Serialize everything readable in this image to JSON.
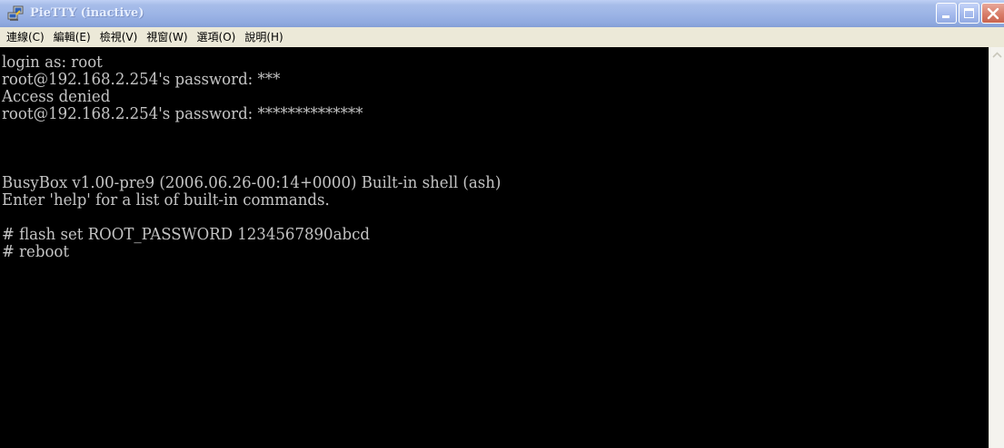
{
  "window": {
    "title": "PieTTY (inactive)"
  },
  "colors": {
    "titlebar": "#9db5e6",
    "terminal_bg": "#000000",
    "terminal_fg": "#c4c4c4",
    "close_button": "#d77a66"
  },
  "icons": {
    "app": "network-computers-icon",
    "minimize": "minimize-icon",
    "maximize": "maximize-icon",
    "close": "close-icon",
    "scroll_up": "chevron-up-icon"
  },
  "menu": [
    {
      "label": "連線(C)"
    },
    {
      "label": "編輯(E)"
    },
    {
      "label": "檢視(V)"
    },
    {
      "label": "視窗(W)"
    },
    {
      "label": "選項(O)"
    },
    {
      "label": "說明(H)"
    }
  ],
  "terminal": {
    "lines": [
      "login as: root",
      "root@192.168.2.254's password: ***",
      "Access denied",
      "root@192.168.2.254's password: **************",
      "",
      "",
      "",
      "BusyBox v1.00-pre9 (2006.06.26-00:14+0000) Built-in shell (ash)",
      "Enter 'help' for a list of built-in commands.",
      "",
      "# flash set ROOT_PASSWORD 1234567890abcd",
      "# reboot"
    ]
  }
}
